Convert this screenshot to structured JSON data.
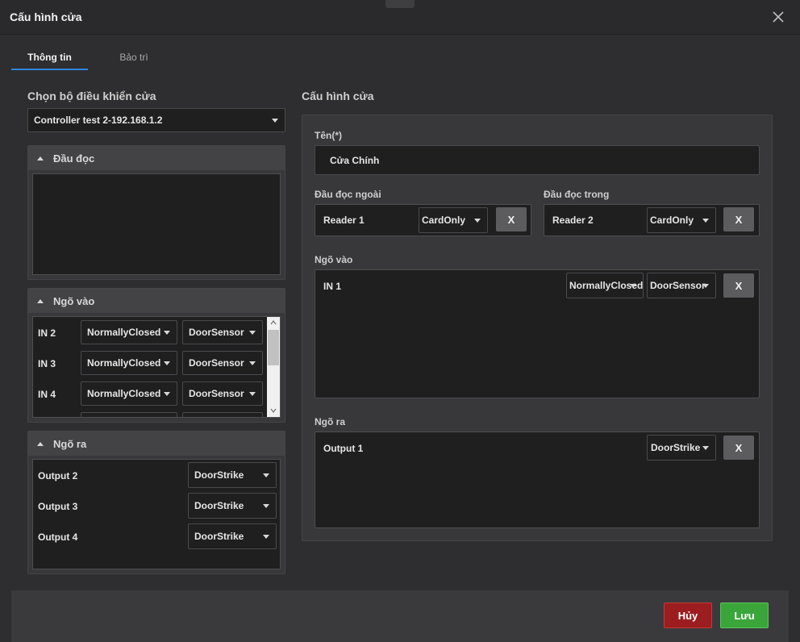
{
  "window": {
    "title": "Cấu hình cửa"
  },
  "tabs": [
    {
      "label": "Thông tin",
      "active": true
    },
    {
      "label": "Bảo trì",
      "active": false
    }
  ],
  "left": {
    "controller_label": "Chọn bộ điều khiển cửa",
    "controller_value": "Controller test 2-192.168.1.2",
    "readers_panel": {
      "title": "Đầu đọc",
      "items": []
    },
    "inputs_panel": {
      "title": "Ngõ vào",
      "rows": [
        {
          "label": "IN 2",
          "mode": "NormallyClosed",
          "type": "DoorSensor"
        },
        {
          "label": "IN 3",
          "mode": "NormallyClosed",
          "type": "DoorSensor"
        },
        {
          "label": "IN 4",
          "mode": "NormallyClosed",
          "type": "DoorSensor"
        }
      ]
    },
    "outputs_panel": {
      "title": "Ngõ ra",
      "rows": [
        {
          "label": "Output 2",
          "type": "DoorStrike"
        },
        {
          "label": "Output 3",
          "type": "DoorStrike"
        },
        {
          "label": "Output 4",
          "type": "DoorStrike"
        }
      ]
    }
  },
  "right": {
    "section_title": "Cấu hình cửa",
    "name_label": "Tên(*)",
    "name_value": "Cửa Chính",
    "outer_reader": {
      "label": "Đầu đọc ngoài",
      "reader": "Reader 1",
      "mode": "CardOnly",
      "remove": "X"
    },
    "inner_reader": {
      "label": "Đầu đọc trong",
      "reader": "Reader 2",
      "mode": "CardOnly",
      "remove": "X"
    },
    "inputs": {
      "label": "Ngõ vào",
      "rows": [
        {
          "label": "IN 1",
          "mode": "NormallyClosed",
          "type": "DoorSensor",
          "remove": "X"
        }
      ]
    },
    "outputs": {
      "label": "Ngõ ra",
      "rows": [
        {
          "label": "Output 1",
          "type": "DoorStrike",
          "remove": "X"
        }
      ]
    }
  },
  "footer": {
    "cancel_label": "Hủy",
    "save_label": "Lưu"
  },
  "colors": {
    "accent": "#2e86de",
    "cancel": "#9c1d1f",
    "save": "#3aa63a"
  }
}
